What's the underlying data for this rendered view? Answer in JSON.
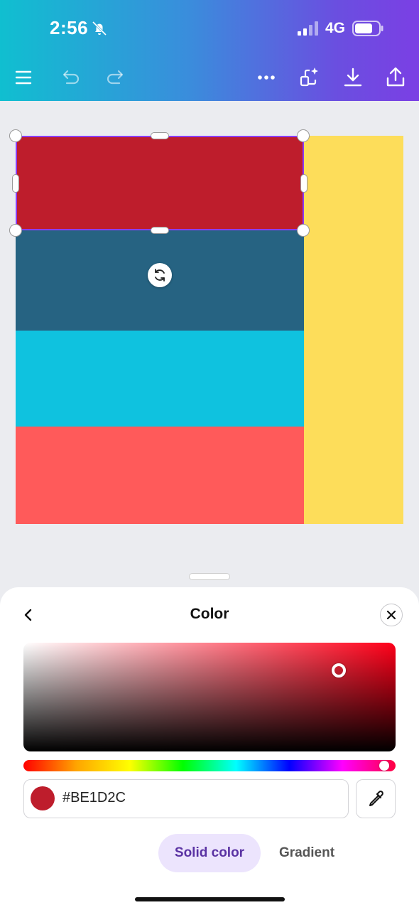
{
  "status_bar": {
    "time": "2:56",
    "network": "4G",
    "icons": [
      "bell-slash-icon",
      "signal-icon",
      "battery-icon"
    ]
  },
  "toolbar": {
    "icons": [
      "menu-icon",
      "undo-icon",
      "redo-icon",
      "more-icon",
      "magic-resize-icon",
      "download-icon",
      "share-icon"
    ]
  },
  "canvas": {
    "blocks": [
      {
        "name": "red",
        "color": "#BE1D2C",
        "selected": true
      },
      {
        "name": "teal",
        "color": "#266382"
      },
      {
        "name": "cyan",
        "color": "#0FC2DF"
      },
      {
        "name": "coral",
        "color": "#FF5A5A"
      },
      {
        "name": "yellow",
        "color": "#FDDD5A"
      }
    ]
  },
  "color_panel": {
    "title": "Color",
    "hex_value": "#BE1D2C",
    "tabs": [
      {
        "label": "Solid color",
        "active": true
      },
      {
        "label": "Gradient",
        "active": false
      }
    ]
  },
  "colors": {
    "accent": "#8B3DFF",
    "selected": "#BE1D2C"
  }
}
